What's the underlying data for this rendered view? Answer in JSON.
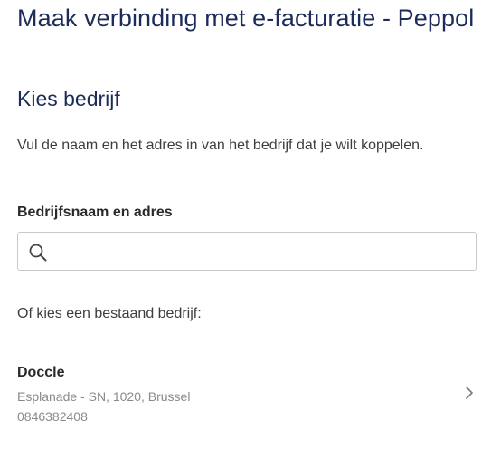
{
  "page": {
    "title": "Maak verbinding met e-facturatie - Peppol",
    "section_title": "Kies bedrijf",
    "description": "Vul de naam en het adres in van het bedrijf dat je wilt koppelen."
  },
  "search": {
    "label": "Bedrijfsnaam en adres",
    "value": "",
    "placeholder": "",
    "icon": "search-icon"
  },
  "existing": {
    "label": "Of kies een bestaand bedrijf:",
    "companies": [
      {
        "name": "Doccle",
        "address": "Esplanade - SN, 1020, Brussel",
        "number": "0846382408",
        "icon": "chevron-right-icon"
      }
    ]
  },
  "colors": {
    "heading": "#1c2b5a",
    "body_text": "#3d3d3d",
    "muted_text": "#8a8a8a",
    "border": "#c9c9c9"
  }
}
